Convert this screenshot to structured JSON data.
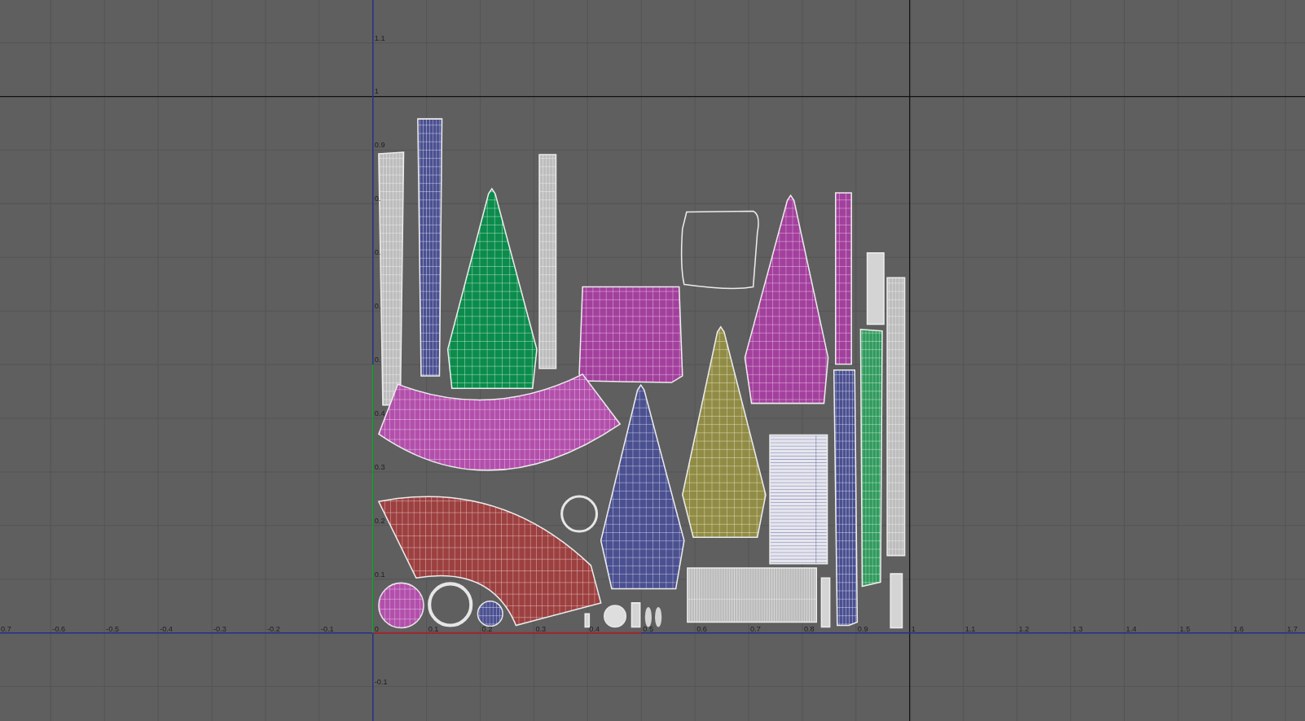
{
  "uv_editor": {
    "u_axis_labels": [
      "0.7",
      "-0.6",
      "-0.5",
      "-0.4",
      "-0.3",
      "-0.2",
      "-0.1",
      "0",
      "0.1",
      "0.2",
      "0.3",
      "0.4",
      "0.5",
      "0.6",
      "0.7",
      "0.8",
      "0.9",
      "1",
      "1.1",
      "1.2",
      "1.3",
      "1.4",
      "1.5",
      "1.6",
      "1.7"
    ],
    "v_axis_labels": [
      "1.1",
      "1",
      "0.9",
      "0.",
      "0.",
      "0.",
      "0.",
      "0.4",
      "0.3",
      "0.2",
      "0.1",
      "-0.1"
    ]
  }
}
